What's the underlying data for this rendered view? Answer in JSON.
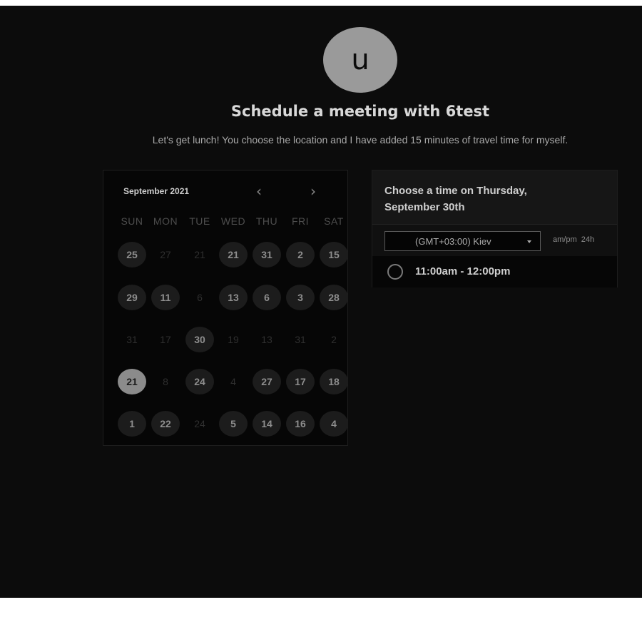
{
  "header": {
    "avatar_letter": "u",
    "title": "Schedule a meeting with 6test",
    "description": "Let's get lunch! You choose the location and I have added 15 minutes of travel time for myself."
  },
  "calendar": {
    "month_label": "September 2021",
    "prev_icon": "chevron-left-icon",
    "next_icon": "chevron-right-icon",
    "weekdays": [
      "SUN",
      "MON",
      "TUE",
      "WED",
      "THU",
      "FRI",
      "SAT"
    ],
    "weeks": [
      [
        {
          "d": "25",
          "s": "a"
        },
        {
          "d": "27",
          "s": "m"
        },
        {
          "d": "21",
          "s": "m"
        },
        {
          "d": "21",
          "s": "a"
        },
        {
          "d": "31",
          "s": "a"
        },
        {
          "d": "2",
          "s": "a"
        },
        {
          "d": "15",
          "s": "a"
        }
      ],
      [
        {
          "d": "29",
          "s": "a"
        },
        {
          "d": "11",
          "s": "a"
        },
        {
          "d": "6",
          "s": "m"
        },
        {
          "d": "13",
          "s": "a"
        },
        {
          "d": "6",
          "s": "a"
        },
        {
          "d": "3",
          "s": "a"
        },
        {
          "d": "28",
          "s": "a"
        }
      ],
      [
        {
          "d": "31",
          "s": "m"
        },
        {
          "d": "17",
          "s": "m"
        },
        {
          "d": "30",
          "s": "a"
        },
        {
          "d": "19",
          "s": "m"
        },
        {
          "d": "13",
          "s": "m"
        },
        {
          "d": "31",
          "s": "m"
        },
        {
          "d": "2",
          "s": "m"
        }
      ],
      [
        {
          "d": "21",
          "s": "sel"
        },
        {
          "d": "8",
          "s": "m"
        },
        {
          "d": "24",
          "s": "a"
        },
        {
          "d": "4",
          "s": "m"
        },
        {
          "d": "27",
          "s": "a"
        },
        {
          "d": "17",
          "s": "a"
        },
        {
          "d": "18",
          "s": "a"
        }
      ],
      [
        {
          "d": "1",
          "s": "a"
        },
        {
          "d": "22",
          "s": "a"
        },
        {
          "d": "24",
          "s": "m"
        },
        {
          "d": "5",
          "s": "a"
        },
        {
          "d": "14",
          "s": "a"
        },
        {
          "d": "16",
          "s": "a"
        },
        {
          "d": "4",
          "s": "a"
        }
      ]
    ]
  },
  "timepanel": {
    "heading": "Choose a time on Thursday, September 30th",
    "timezone": "(GMT+03:00) Kiev",
    "format_toggle": "am/pm  24h",
    "slots": [
      {
        "label": "11:00am - 12:00pm"
      }
    ]
  },
  "colors": {
    "background": "#0c0c0c",
    "avatar": "#9a9a9a",
    "selected_day": "#8b8b8b"
  }
}
